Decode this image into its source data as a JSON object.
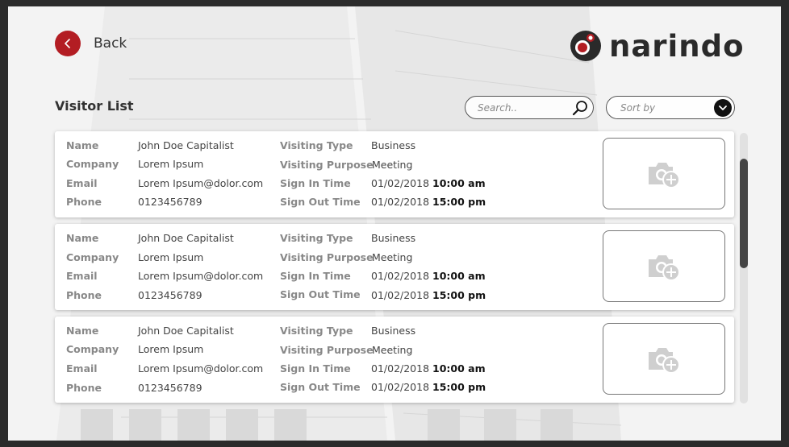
{
  "header": {
    "back_label": "Back",
    "brand": "narindo"
  },
  "page": {
    "title": "Visitor List"
  },
  "search": {
    "placeholder": "Search.."
  },
  "sort": {
    "label": "Sort by"
  },
  "labels": {
    "name": "Name",
    "company": "Company",
    "email": "Email",
    "phone": "Phone",
    "visiting_type": "Visiting Type",
    "visiting_purpose": "Visiting Purpose",
    "sign_in_time": "Sign In Time",
    "sign_out_time": "Sign Out Time"
  },
  "visitors": [
    {
      "name": "John Doe Capitalist",
      "company": "Lorem Ipsum",
      "email": "Lorem Ipsum@dolor.com",
      "phone": "0123456789",
      "visiting_type": "Business",
      "visiting_purpose": "Meeting",
      "sign_in_date": "01/02/2018",
      "sign_in_time": "10:00 am",
      "sign_out_date": "01/02/2018",
      "sign_out_time": "15:00 pm"
    },
    {
      "name": "John Doe Capitalist",
      "company": "Lorem Ipsum",
      "email": "Lorem Ipsum@dolor.com",
      "phone": "0123456789",
      "visiting_type": "Business",
      "visiting_purpose": "Meeting",
      "sign_in_date": "01/02/2018",
      "sign_in_time": "10:00 am",
      "sign_out_date": "01/02/2018",
      "sign_out_time": "15:00 pm"
    },
    {
      "name": "John Doe Capitalist",
      "company": "Lorem Ipsum",
      "email": "Lorem Ipsum@dolor.com",
      "phone": "0123456789",
      "visiting_type": "Business",
      "visiting_purpose": "Meeting",
      "sign_in_date": "01/02/2018",
      "sign_in_time": "10:00 am",
      "sign_out_date": "01/02/2018",
      "sign_out_time": "15:00 pm"
    }
  ],
  "colors": {
    "accent": "#b31d23",
    "text_dark": "#333333",
    "label_gray": "#888888"
  },
  "icons": {
    "back": "chevron-left-icon",
    "logo": "narindo-logo-mark",
    "search": "search-icon",
    "sort": "chevron-down-icon",
    "photo": "camera-add-icon"
  }
}
